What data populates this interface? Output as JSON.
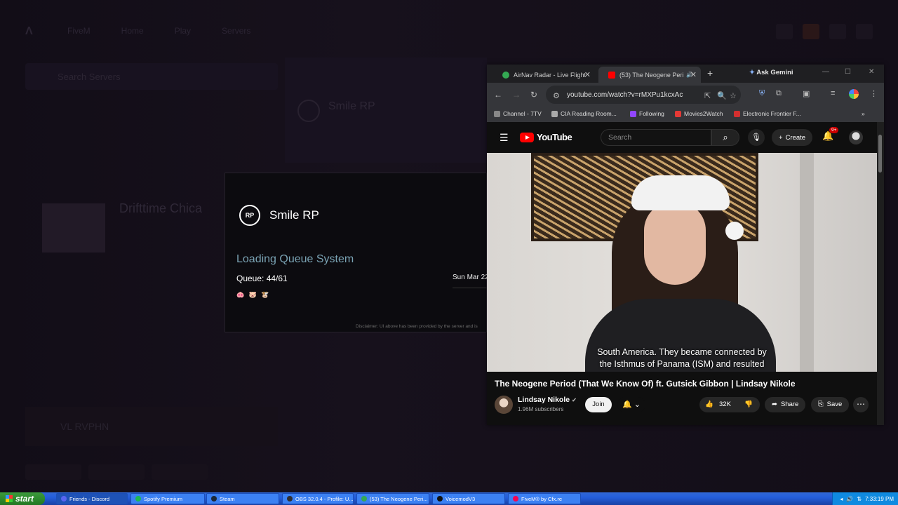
{
  "background_app": {
    "nav": [
      "FiveM",
      "Home",
      "Play",
      "Servers"
    ],
    "search_placeholder": "Search Servers",
    "card_title": "Smile RP",
    "server_title": "Drifttime Chica",
    "footer_text": "VL RVPHN"
  },
  "queue_overlay": {
    "logo_text": "RP",
    "server_name": "Smile RP",
    "loading_label": "Loading Queue System",
    "queue_text": "Queue: 44/61",
    "emojis": "🐽 🐷 🐮",
    "date_text": "Sun Mar 22",
    "disclaimer": "Disclaimer: UI above has been provided by the server and is"
  },
  "browser": {
    "tabs": [
      {
        "title": "AirNav Radar - Live Flight",
        "favicon_color": "#34a853"
      },
      {
        "title": "(53) The Neogene Peri",
        "favicon_color": "#ff0000"
      }
    ],
    "new_tab_icon": "+",
    "gemini_label": "Ask Gemini",
    "url": "youtube.com/watch?v=rMXPu1kcxAc",
    "bookmarks": [
      {
        "label": "Channel - 7TV",
        "color": "#888"
      },
      {
        "label": "CIA Reading Room...",
        "color": "#aaa"
      },
      {
        "label": "Following",
        "color": "#9146ff"
      },
      {
        "label": "Movies2Watch",
        "color": "#e53935"
      },
      {
        "label": "Electronic Frontier F...",
        "color": "#d32f2f"
      }
    ]
  },
  "youtube": {
    "logo_text": "YouTube",
    "search_placeholder": "Search",
    "create_label": "Create",
    "notif_badge": "9+",
    "subtitle_line1": "South America. They became connected by",
    "subtitle_line2": "the Isthmus of Panama (ISM) and resulted",
    "video_title": "The Neogene Period (That We Know Of) ft. Gutsick Gibbon | Lindsay Nikole",
    "channel_name": "Lindsay Nikole",
    "subscribers": "1.96M subscribers",
    "join_label": "Join",
    "likes": "32K",
    "share_label": "Share",
    "save_label": "Save"
  },
  "taskbar": {
    "start_label": "start",
    "tasks": [
      {
        "label": "Friends - Discord",
        "color": "#5865f2",
        "active": true
      },
      {
        "label": "Spotify Premium",
        "color": "#1db954",
        "active": false
      },
      {
        "label": "Steam",
        "color": "#1b2838",
        "active": false
      },
      {
        "label": "OBS 32.0.4 - Profile: U...",
        "color": "#302e31",
        "active": false
      },
      {
        "label": "(53) The Neogene Peri...",
        "color": "#34a853",
        "active": false
      },
      {
        "label": "VoicemodV3",
        "color": "#111",
        "active": false
      },
      {
        "label": "FiveM® by Cfx.re",
        "color": "#f40552",
        "active": false
      }
    ],
    "clock": "7:33:19 PM"
  }
}
